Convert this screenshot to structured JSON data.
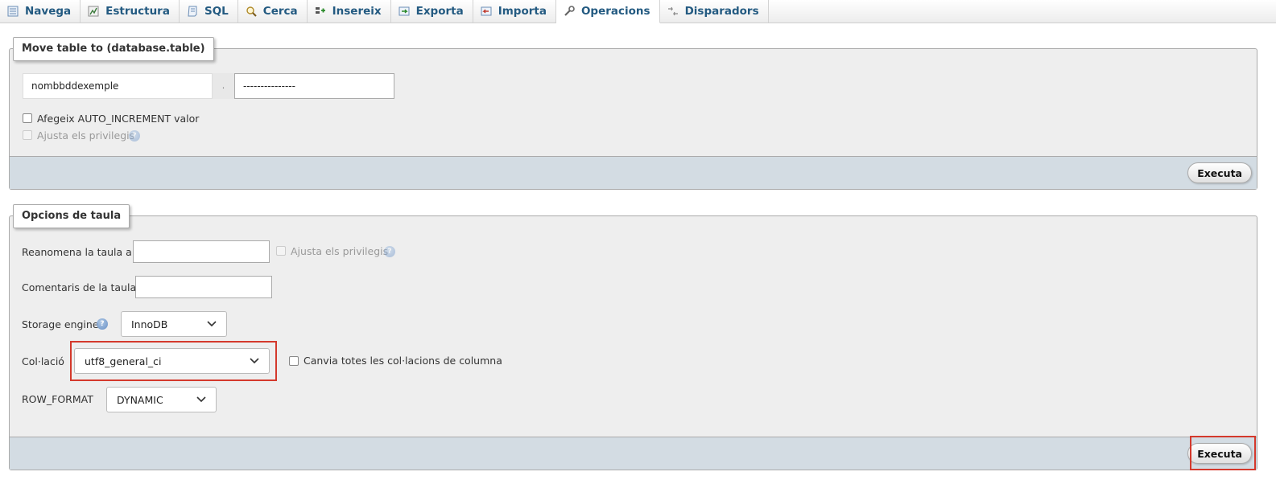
{
  "tabs": [
    {
      "label": "Navega",
      "icon": "browse-icon"
    },
    {
      "label": "Estructura",
      "icon": "structure-icon"
    },
    {
      "label": "SQL",
      "icon": "sql-icon"
    },
    {
      "label": "Cerca",
      "icon": "search-icon"
    },
    {
      "label": "Insereix",
      "icon": "insert-icon"
    },
    {
      "label": "Exporta",
      "icon": "export-icon"
    },
    {
      "label": "Importa",
      "icon": "import-icon"
    },
    {
      "label": "Operacions",
      "icon": "wrench-icon",
      "active": true
    },
    {
      "label": "Disparadors",
      "icon": "triggers-icon"
    }
  ],
  "move_table": {
    "legend": "Move table to (database.table)",
    "database_value": "nombbddexemple",
    "separator": ".",
    "table_value": "---------------",
    "auto_increment_label": "Afegeix AUTO_INCREMENT valor",
    "privileges_label": "Ajusta els privilegis",
    "submit_label": "Executa"
  },
  "table_options": {
    "legend": "Opcions de taula",
    "rename_label": "Reanomena la taula a",
    "rename_value": "",
    "rename_privileges_label": "Ajusta els privilegis",
    "comments_label": "Comentaris de la taula",
    "comments_value": "",
    "engine_label": "Storage engine",
    "engine_value": "InnoDB",
    "collation_label": "Col·lació",
    "collation_value": "utf8_general_ci",
    "change_all_collations_label": "Canvia totes les col·lacions de columna",
    "row_format_label": "ROW_FORMAT",
    "row_format_value": "DYNAMIC",
    "submit_label": "Executa"
  },
  "colors": {
    "tab_text": "#235a81",
    "fieldset_bg": "#eeeeee",
    "footer_bg": "#d3dce3",
    "highlight": "#d4392c"
  }
}
